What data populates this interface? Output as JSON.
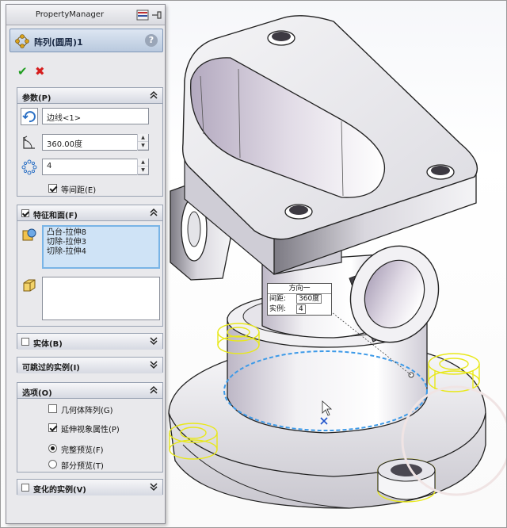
{
  "panel": {
    "title": "PropertyManager",
    "feature_name": "阵列(圆周)1",
    "help": "?"
  },
  "parameters": {
    "header": "参数(P)",
    "axis_value": "边线<1>",
    "angle_value": "360.00度",
    "count_value": "4",
    "equal_spacing_label": "等间距(E)",
    "equal_spacing_checked": true
  },
  "features": {
    "header": "特征和面(F)",
    "checked": true,
    "items": [
      "凸台-拉伸8",
      "切除-拉伸3",
      "切除-拉伸4"
    ]
  },
  "bodies": {
    "header": "实体(B)",
    "checked": false
  },
  "skip_instances": {
    "header": "可跳过的实例(I)"
  },
  "options": {
    "header": "选项(O)",
    "geometry_pattern_label": "几何体阵列(G)",
    "geometry_pattern_checked": false,
    "propagate_visual_label": "延伸视象属性(P)",
    "propagate_visual_checked": true,
    "full_preview_label": "完整预览(F)",
    "partial_preview_label": "部分预览(T)",
    "selected_preview": "full"
  },
  "varying_instances": {
    "header": "变化的实例(V)",
    "checked": false
  },
  "callout": {
    "title": "方向一",
    "spacing_label": "间距:",
    "spacing_value": "360度",
    "instances_label": "实例:",
    "instances_value": "4"
  },
  "colors": {
    "preview_circle": "#3d9ae8",
    "preview_features": "#e8e81a",
    "ok": "#1f9d1f",
    "cancel": "#d61e1e"
  }
}
